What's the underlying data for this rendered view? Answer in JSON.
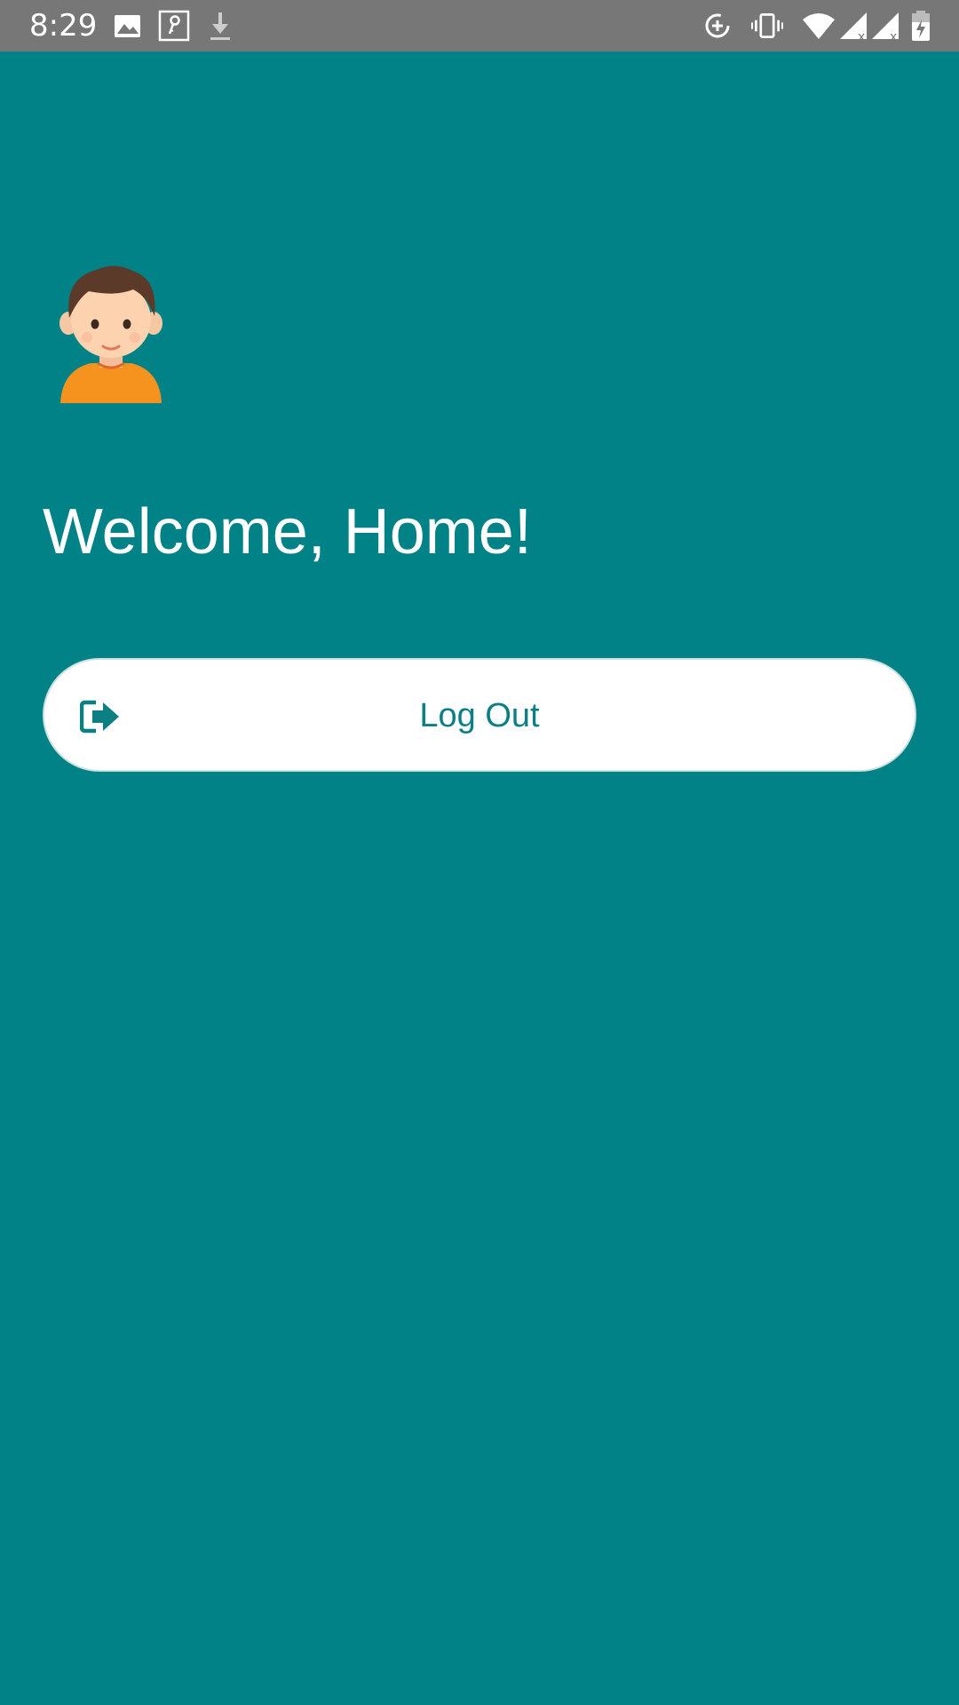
{
  "status_bar": {
    "time": "8:29",
    "icons_left": [
      "image-icon",
      "key-icon",
      "download-icon"
    ],
    "icons_right": [
      "data-saver-icon",
      "vibrate-icon",
      "wifi-icon",
      "signal-no-data-icon",
      "signal-no-data-icon-2",
      "battery-charging-icon"
    ]
  },
  "main": {
    "avatar_icon": "user-avatar-icon",
    "welcome_text": "Welcome, Home!",
    "logout": {
      "label": "Log Out",
      "icon": "logout-icon"
    }
  },
  "colors": {
    "background": "#008287",
    "status_bar": "#777777",
    "button_background": "#ffffff",
    "button_text": "#0b7f84",
    "welcome_text": "#ffffff"
  }
}
